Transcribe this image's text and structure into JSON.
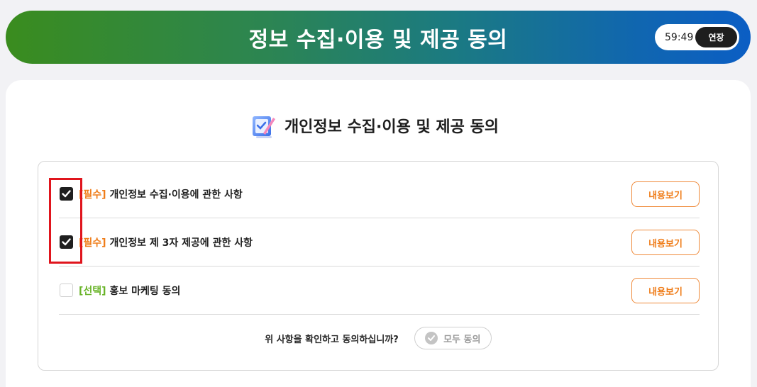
{
  "header": {
    "title": "정보 수집·이용 및 제공 동의",
    "timer": "59:49",
    "extend_label": "연장"
  },
  "section": {
    "title": "개인정보 수집·이용 및 제공 동의",
    "icon": "checklist-pencil-icon"
  },
  "rows": [
    {
      "tag": "[필수]",
      "label": "개인정보 수집·이용에 관한 사항",
      "checked": true,
      "button": "내용보기"
    },
    {
      "tag": "[필수]",
      "label": "개인정보 제 3자 제공에 관한 사항",
      "checked": true,
      "button": "내용보기"
    },
    {
      "tag": "[선택]",
      "label": "홍보 마케팅 동의",
      "checked": false,
      "button": "내용보기"
    }
  ],
  "footer": {
    "question": "위 사항을 확인하고 동의하십니까?",
    "all_agree_label": "모두 동의"
  },
  "colors": {
    "required_tag": "#ef7d1a",
    "optional_tag": "#6ab42a",
    "highlight": "#e0151d"
  }
}
